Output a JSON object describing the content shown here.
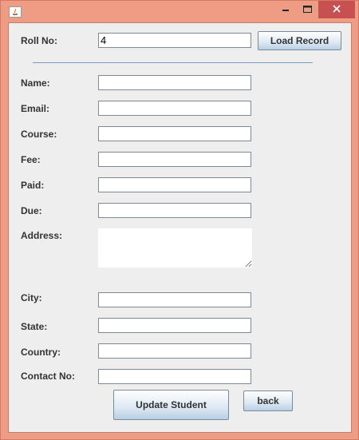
{
  "form": {
    "roll_label": "Roll No:",
    "roll_value": "4",
    "load_button": "Load Record",
    "fields": [
      {
        "label": "Name:",
        "value": ""
      },
      {
        "label": "Email:",
        "value": ""
      },
      {
        "label": "Course:",
        "value": ""
      },
      {
        "label": "Fee:",
        "value": ""
      },
      {
        "label": "Paid:",
        "value": ""
      },
      {
        "label": "Due:",
        "value": ""
      }
    ],
    "address_label": "Address:",
    "address_value": "",
    "fields2": [
      {
        "label": "City:",
        "value": ""
      },
      {
        "label": "State:",
        "value": ""
      },
      {
        "label": "Country:",
        "value": ""
      },
      {
        "label": "Contact No:",
        "value": ""
      }
    ],
    "update_button": "Update Student",
    "back_button": "back"
  },
  "colors": {
    "frame": "#ee9c84",
    "close_button": "#c75050",
    "panel": "#eeeeee",
    "separator": "#7a99bb"
  },
  "icons": [
    "java-icon",
    "minimize-icon",
    "maximize-icon",
    "close-icon"
  ]
}
